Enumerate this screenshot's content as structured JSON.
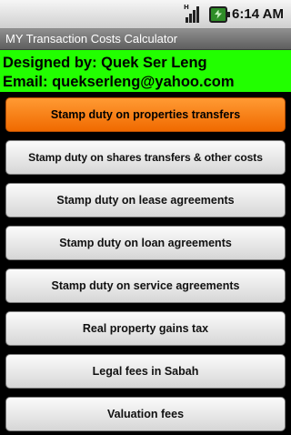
{
  "status_bar": {
    "time": "6:14",
    "ampm": "AM",
    "signal_tag": "H",
    "icons": [
      "signal-icon",
      "battery-charging-icon"
    ]
  },
  "app": {
    "title": "MY Transaction Costs Calculator"
  },
  "credits": {
    "designer": "Designed by: Quek Ser Leng",
    "email": "Email: quekserleng@yahoo.com"
  },
  "menu": {
    "items": [
      {
        "label": "Stamp duty on properties transfers",
        "selected": true
      },
      {
        "label": "Stamp duty on shares transfers & other costs"
      },
      {
        "label": "Stamp duty on lease agreements"
      },
      {
        "label": "Stamp duty on loan agreements"
      },
      {
        "label": "Stamp duty on service agreements"
      },
      {
        "label": "Real property gains tax"
      },
      {
        "label": "Legal fees in Sabah"
      },
      {
        "label": "Valuation fees"
      }
    ]
  },
  "colors": {
    "credits_background": "#22ff00",
    "selected_item": "#f57e12",
    "title_bar": "#6e6e6e"
  }
}
